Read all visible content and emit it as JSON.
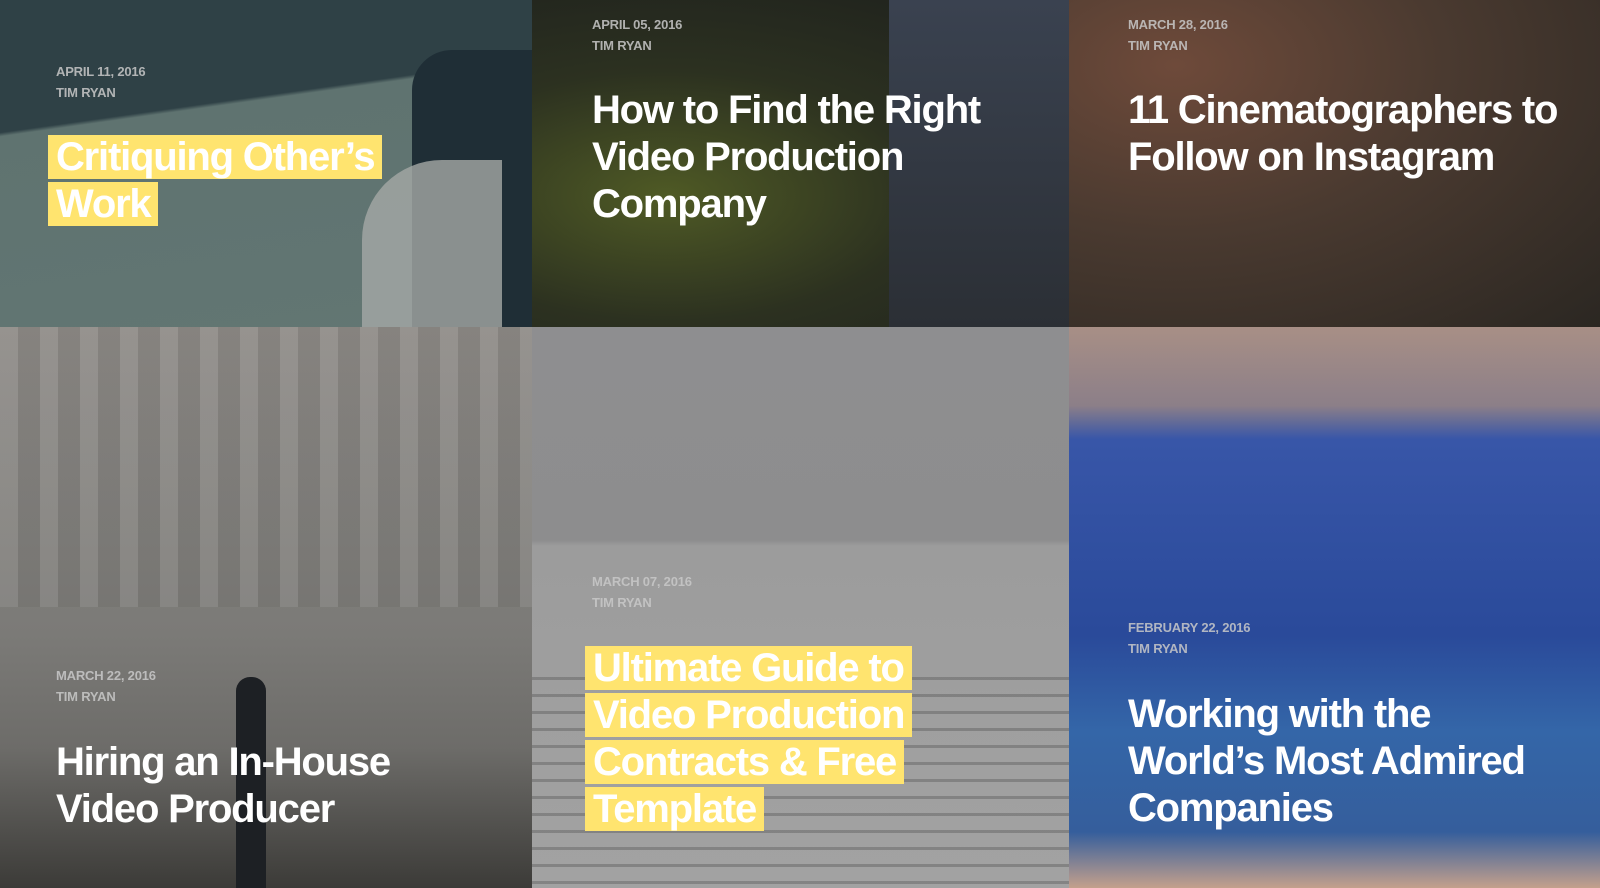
{
  "posts": [
    {
      "date": "APRIL 11, 2016",
      "author": "TIM RYAN",
      "title": "Critiquing Other’s Work",
      "highlighted": true
    },
    {
      "date": "APRIL 05, 2016",
      "author": "TIM RYAN",
      "title": "How to Find the Right Video Production Company",
      "highlighted": false
    },
    {
      "date": "MARCH 28, 2016",
      "author": "TIM RYAN",
      "title": "11 Cinematographers to Follow on Instagram",
      "highlighted": false
    },
    {
      "date": "MARCH 22, 2016",
      "author": "TIM RYAN",
      "title": "Hiring an In-House Video Producer",
      "highlighted": false
    },
    {
      "date": "MARCH 07, 2016",
      "author": "TIM RYAN",
      "title": "Ultimate Guide to Video Production Contracts & Free Template",
      "highlighted": true
    },
    {
      "date": "FEBRUARY 22, 2016",
      "author": "TIM RYAN",
      "title": "Working with the World’s Most Admired Companies",
      "highlighted": false
    }
  ],
  "colors": {
    "highlight": "#ffe46f"
  }
}
